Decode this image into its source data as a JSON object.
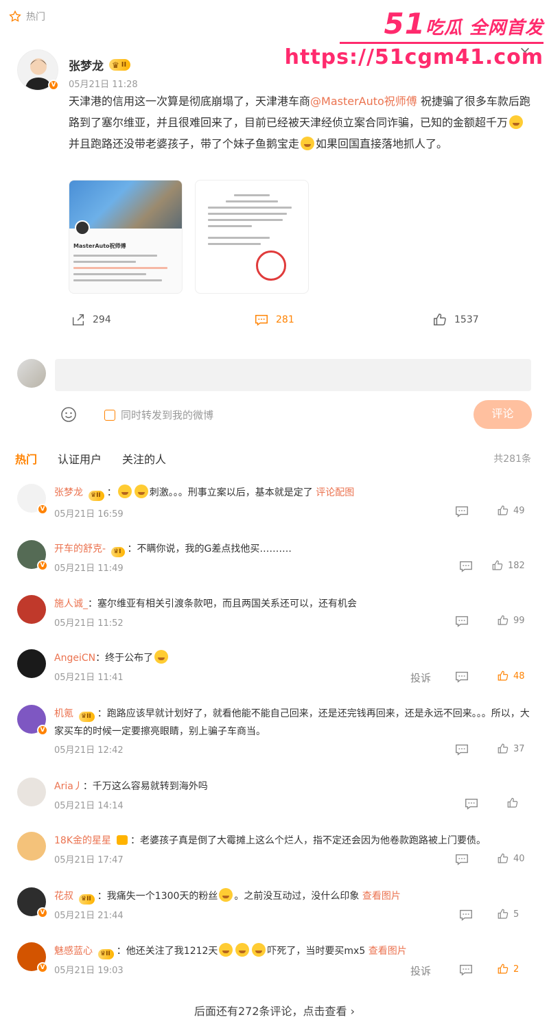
{
  "topbar": {
    "label": "热门"
  },
  "watermark": {
    "brand_num": "51",
    "brand_text": "吃瓜 全网首发",
    "url": "https://51cgm41.com"
  },
  "post": {
    "author": "张梦龙",
    "badge_level": "II",
    "time": "05月21日 11:28",
    "text_1": "天津港的信用这一次算是彻底崩塌了，天津港车商",
    "mention": "@MasterAuto祝师傅",
    "text_2": " 祝捷骗了很多车款后跑路到了塞尔维亚，并且很难回来了，目前已经被天津经侦立案合同诈骗，已知的金额超千万",
    "text_3": "并且跑路还没带老婆孩子，带了个妹子鱼鹅宝走",
    "text_4": "如果回国直接落地抓人了。",
    "thumb1_name": "MasterAuto祝师傅",
    "actions": {
      "forward": "294",
      "comment": "281",
      "like": "1537"
    }
  },
  "composer": {
    "forward_label": "同时转发到我的微博",
    "submit_label": "评论"
  },
  "tabs": {
    "hot": "热门",
    "verified": "认证用户",
    "following": "关注的人",
    "total": "共281条"
  },
  "comments": [
    {
      "name": "张梦龙",
      "badge": "II",
      "text": "：",
      "text2": "刺激。。。刑事立案以后，基本就是定了 ",
      "link": "评论配图",
      "time": "05月21日 16:59",
      "likes": "49"
    },
    {
      "name": "开车的舒克-",
      "badge": "I",
      "text": "：不瞒你说，我的G差点找他买……….",
      "time": "05月21日 11:49",
      "likes": "182"
    },
    {
      "name": "施人诚_",
      "text": "：塞尔维亚有相关引渡条款吧，而且两国关系还可以，还有机会",
      "time": "05月21日 11:52",
      "likes": "99"
    },
    {
      "name": "AngeiCN",
      "text": "：终于公布了",
      "time": "05月21日 11:41",
      "report": "投诉",
      "likes": "48"
    },
    {
      "name": "机氪",
      "badge": "II",
      "text": "：跑路应该早就计划好了，就看他能不能自己回来，还是还完钱再回来，还是永远不回来。。。所以，大家买车的时候一定要擦亮眼睛，别上骗子车商当。",
      "time": "05月21日 12:42",
      "likes": "37"
    },
    {
      "name": "Aria丿",
      "text": "：千万这么容易就转到海外吗",
      "time": "05月21日 14:14",
      "likes": ""
    },
    {
      "name": "18K金的星星",
      "text": "：老婆孩子真是倒了大霉摊上这么个烂人，指不定还会因为他卷款跑路被上门要债。",
      "time": "05月21日 17:47",
      "likes": "40"
    },
    {
      "name": "花叔",
      "badge": "II",
      "text": "：我痛失一个1300天的粉丝",
      "text2": "。之前没互动过，没什么印象 ",
      "link": "查看图片",
      "time": "05月21日 21:44",
      "likes": "5"
    },
    {
      "name": "魅感蓝心",
      "badge": "II",
      "text": "：他还关注了我1212天",
      "text2": "吓死了，当时要买mx5 ",
      "link": "查看图片",
      "time": "05月21日 19:03",
      "report": "投诉",
      "likes": "2"
    }
  ],
  "more_label": "后面还有272条评论，点击查看",
  "colors": {
    "accent": "#ff8200",
    "name": "#eb7350",
    "watermark": "#ff2a6d"
  }
}
